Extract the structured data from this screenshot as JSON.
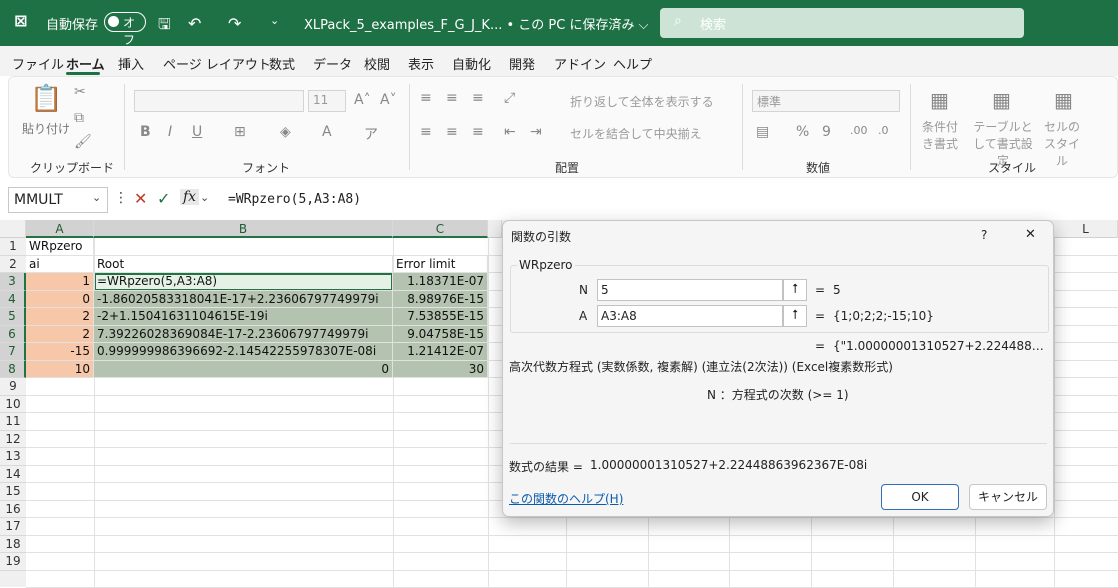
{
  "titlebar": {
    "autosave_label": "自動保存",
    "autosave_state": "オフ",
    "filename": "XLPack_5_examples_F_G_J_K... • この PC に保存済み ⌵",
    "search_placeholder": "検索"
  },
  "menu": [
    "ファイル",
    "ホーム",
    "挿入",
    "ページ レイアウト",
    "数式",
    "データ",
    "校閲",
    "表示",
    "自動化",
    "開発",
    "アドイン",
    "ヘルプ"
  ],
  "ribbon": {
    "paste": "貼り付け",
    "clipboard": "クリップボード",
    "font_group": "フォント",
    "font_size": "11",
    "wrap_text": "折り返して全体を表示する",
    "merge_center": "セルを結合して中央揃え",
    "alignment": "配置",
    "number_format": "標準",
    "number": "数値",
    "cond_format": "条件付き書式",
    "format_table": "テーブルとして書式設定",
    "cell_style": "セルのスタイル",
    "styles": "スタイル"
  },
  "formula_bar": {
    "name_box": "MMULT",
    "fx": "fx",
    "formula": "=WRpzero(5,A3:A8)"
  },
  "sheet": {
    "columns": [
      "A",
      "B",
      "C",
      "D",
      "E",
      "F",
      "G",
      "H",
      "I",
      "J",
      "K",
      "L"
    ],
    "rows": [
      "1",
      "2",
      "3",
      "4",
      "5",
      "6",
      "7",
      "8",
      "9",
      "10",
      "11",
      "12",
      "13",
      "14",
      "15",
      "16",
      "17",
      "18",
      "19"
    ],
    "A1": "WRpzero",
    "A2": "ai",
    "B2": "Root",
    "C2": "Error limit",
    "A": [
      "1",
      "0",
      "2",
      "2",
      "-15",
      "10"
    ],
    "B": [
      "=WRpzero(5,A3:A8)",
      "-1.86020583318041E-17+2.23606797749979i",
      "-2+1.15041631104615E-19i",
      "7.39226028369084E-17-2.23606797749979i",
      "0.999999986396692-2.14542255978307E-08i",
      "0"
    ],
    "C": [
      "1.18371E-07",
      "8.98976E-15",
      "7.53855E-15",
      "9.04758E-15",
      "1.21412E-07",
      "30"
    ]
  },
  "dialog": {
    "title": "関数の引数",
    "help_q": "?",
    "close": "✕",
    "func_name": "WRpzero",
    "arg1_label": "N",
    "arg1_value": "5",
    "arg1_result": "5",
    "arg2_label": "A",
    "arg2_value": "A3:A8",
    "arg2_result": "{1;0;2;2;-15;10}",
    "eq": "=",
    "overall_result": "{\"1.00000001310527+2.224488…",
    "description": "高次代数方程式 (実数係数, 複素解) (連立法(2次法)) (Excel複素数形式)",
    "arg_help": "N ：方程式の次数 (>= 1)",
    "result_label": "数式の結果 =",
    "result_value": "1.00000001310527+2.22448863962367E-08i",
    "help_link": "この関数のヘルプ(H)",
    "ok": "OK",
    "cancel": "キャンセル"
  },
  "colors": {
    "excel_green": "#1e7145",
    "orange_fill": "#f7c7a9",
    "green_fill": "#b4c2b0"
  }
}
